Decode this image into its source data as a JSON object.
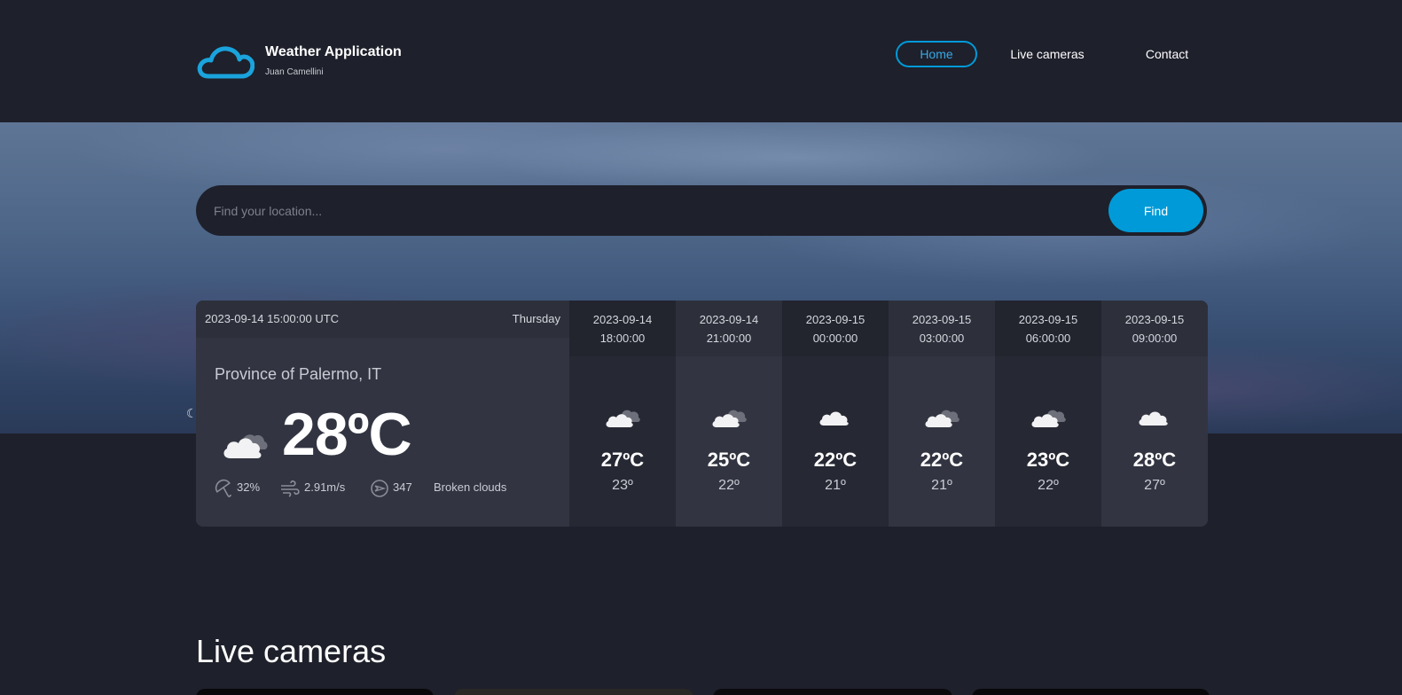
{
  "header": {
    "title": "Weather Application",
    "subtitle": "Juan Camellini",
    "logo_icon": "cloud-icon",
    "nav": [
      {
        "label": "Home",
        "active": true
      },
      {
        "label": "Live cameras",
        "active": false
      },
      {
        "label": "Contact",
        "active": false
      }
    ]
  },
  "search": {
    "placeholder": "Find your location...",
    "button_label": "Find"
  },
  "today": {
    "datetime": "2023-09-14 15:00:00 UTC",
    "day": "Thursday",
    "location": "Province of Palermo, IT",
    "temperature": "28ºC",
    "icon": "broken-clouds-icon",
    "humidity": "32%",
    "wind": "2.91m/s",
    "wind_deg": "347",
    "description": "Broken clouds"
  },
  "hourly": [
    {
      "date": "2023-09-14",
      "time": "18:00:00",
      "temp": "27ºC",
      "min": "23º",
      "icon": "broken-clouds-icon"
    },
    {
      "date": "2023-09-14",
      "time": "21:00:00",
      "temp": "25ºC",
      "min": "22º",
      "icon": "broken-clouds-icon"
    },
    {
      "date": "2023-09-15",
      "time": "00:00:00",
      "temp": "22ºC",
      "min": "21º",
      "icon": "cloud-icon"
    },
    {
      "date": "2023-09-15",
      "time": "03:00:00",
      "temp": "22ºC",
      "min": "21º",
      "icon": "broken-clouds-icon"
    },
    {
      "date": "2023-09-15",
      "time": "06:00:00",
      "temp": "23ºC",
      "min": "22º",
      "icon": "broken-clouds-icon"
    },
    {
      "date": "2023-09-15",
      "time": "09:00:00",
      "temp": "28ºC",
      "min": "27º",
      "icon": "cloud-icon"
    }
  ],
  "live_cameras": {
    "title": "Live cameras"
  },
  "colors": {
    "background": "#1e202b",
    "accent": "#009ad8",
    "panel": "#323541",
    "panel_dark": "#262833"
  }
}
